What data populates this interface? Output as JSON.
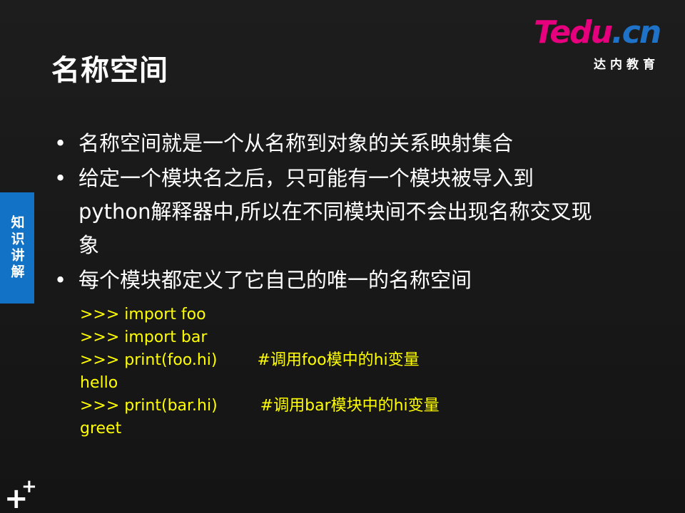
{
  "slide": {
    "title": "名称空间",
    "logo": {
      "brand_t": "T",
      "brand_edu": "edu",
      "brand_dot": ".",
      "brand_cn": "cn",
      "subtitle": "达内教育"
    },
    "side_tab": "知识讲解",
    "bullets": [
      "名称空间就是一个从名称到对象的关系映射集合",
      "给定一个模块名之后，只可能有一个模块被导入到python解释器中,所以在不同模块间不会出现名称交叉现象",
      "每个模块都定义了它自己的唯一的名称空间"
    ],
    "bullet_marker": "•",
    "code_lines": [
      {
        "code": ">>> import foo",
        "comment": ""
      },
      {
        "code": ">>> import bar",
        "comment": ""
      },
      {
        "code": ">>> print(foo.hi)",
        "comment": "#调用foo模中的hi变量"
      },
      {
        "code": "hello",
        "comment": ""
      },
      {
        "code": ">>> print(bar.hi)",
        "comment": "#调用bar模块中的hi变量"
      },
      {
        "code": "greet",
        "comment": ""
      }
    ],
    "footer_mark_big": "+",
    "footer_mark_small": "+"
  },
  "colors": {
    "background": "#1a1a1a",
    "title": "#ffffff",
    "body_text": "#ffffff",
    "code_text": "#ffff00",
    "side_tab": "#1273c6",
    "logo_magenta": "#e6007e",
    "logo_blue": "#1e73c8"
  }
}
